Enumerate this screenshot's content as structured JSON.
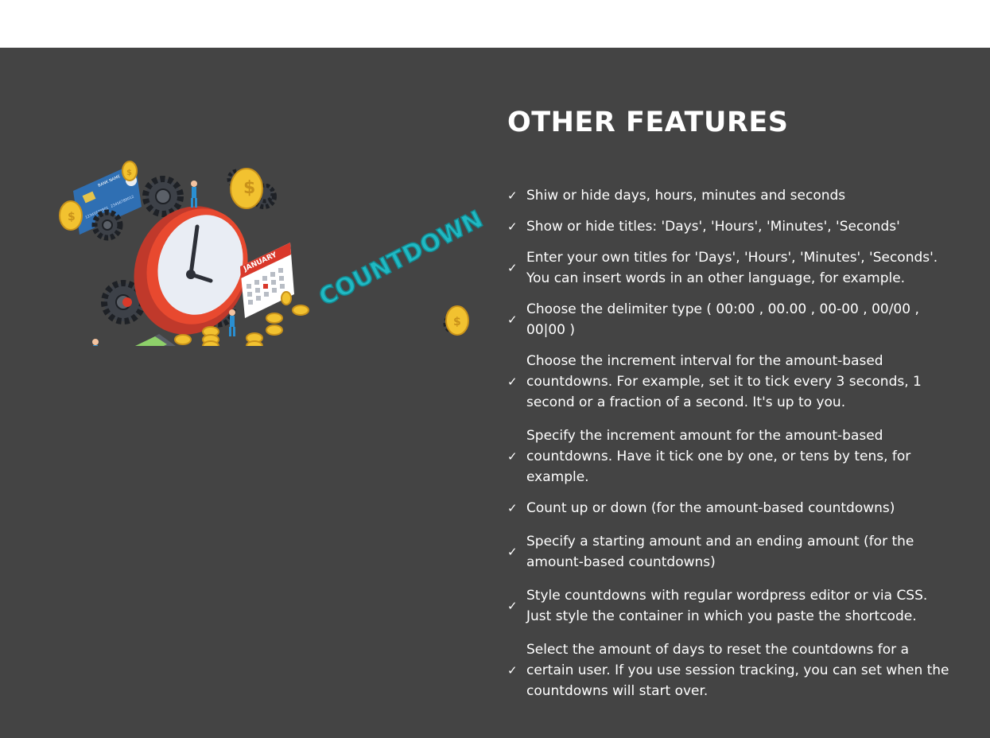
{
  "section": {
    "title": "OTHER FEATURES",
    "illustration": {
      "word": "COUNTDOWN",
      "calendar_month": "JANUARY",
      "card_bank_name": "BANK NAME",
      "card_number_1": "12345678901",
      "card_number_2": "23456789012",
      "coin_symbol": "$"
    },
    "check_glyph": "✓",
    "features": [
      "Shiw or hide days, hours, minutes and seconds",
      "Show or hide titles: 'Days', 'Hours', 'Minutes', 'Seconds'",
      "Enter your own titles for 'Days', 'Hours', 'Minutes', 'Seconds'. You can insert words in an other language, for example.",
      "Choose the delimiter type ( 00:00 , 00.00 , 00-00 , 00/00 , 00|00 )",
      "Choose the increment interval for the amount-based countdowns. For example, set it to tick every 3 seconds, 1 second or a fraction of a second. It's up to you.",
      "Specify the increment amount for the amount-based countdowns. Have it tick one by one, or tens by tens, for example.",
      "Count up or down (for the amount-based countdowns)",
      "Specify a starting amount and an ending amount (for the amount-based countdowns)",
      "Style countdowns with regular wordpress editor or via CSS. Just style the container in which you paste the shortcode.",
      "Select the amount of days to reset the countdowns for a certain user. If you use session tracking, you can set when the countdowns will start over."
    ]
  }
}
